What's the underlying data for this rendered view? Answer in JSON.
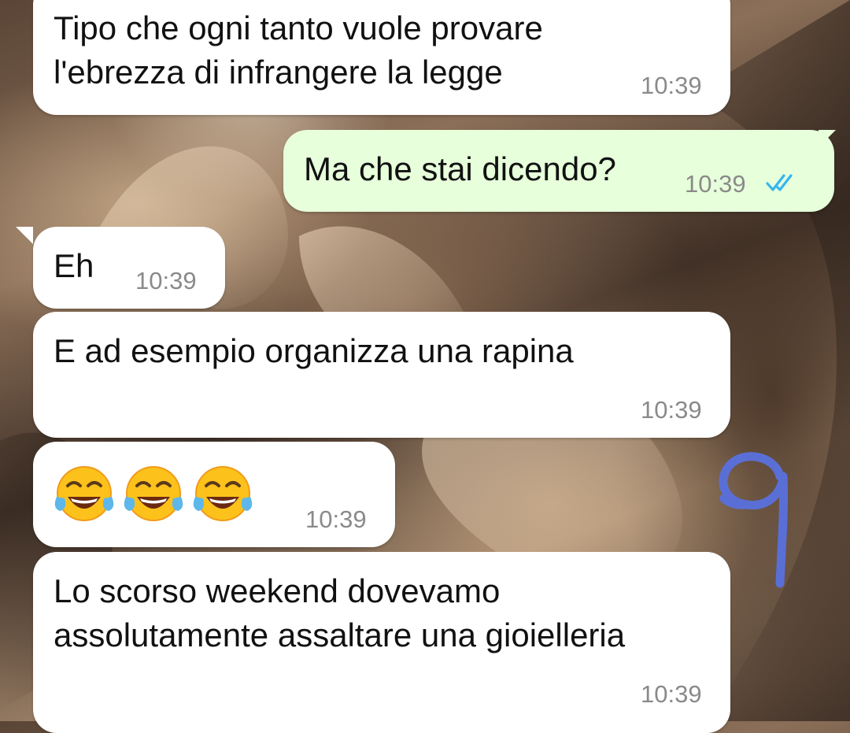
{
  "chat": {
    "messages": [
      {
        "direction": "incoming",
        "text": "Tipo che ogni tanto vuole provare\nl'ebrezza di infrangere la legge",
        "time": "10:39"
      },
      {
        "direction": "outgoing",
        "text": "Ma che stai dicendo?",
        "time": "10:39",
        "status_icon": "double-check-read-icon"
      },
      {
        "direction": "incoming",
        "text": "Eh",
        "time": "10:39"
      },
      {
        "direction": "incoming",
        "text": "E ad esempio organizza una rapina",
        "time": "10:39"
      },
      {
        "direction": "incoming",
        "emoji": [
          "😂",
          "😂",
          "😂"
        ],
        "emoji_icon": "face-with-tears-of-joy-icon",
        "time": "10:39"
      },
      {
        "direction": "incoming",
        "text": "Lo scorso weekend dovevamo\nassolutamente assaltare una gioielleria",
        "time": "10:39"
      }
    ]
  },
  "annotation": {
    "icon": "hand-drawn-number-9",
    "color": "#5a6fd6"
  },
  "colors": {
    "incoming_bubble": "#ffffff",
    "outgoing_bubble": "#e7ffdb",
    "timestamp": "#8a8a8a",
    "read_check": "#34b7f1"
  }
}
